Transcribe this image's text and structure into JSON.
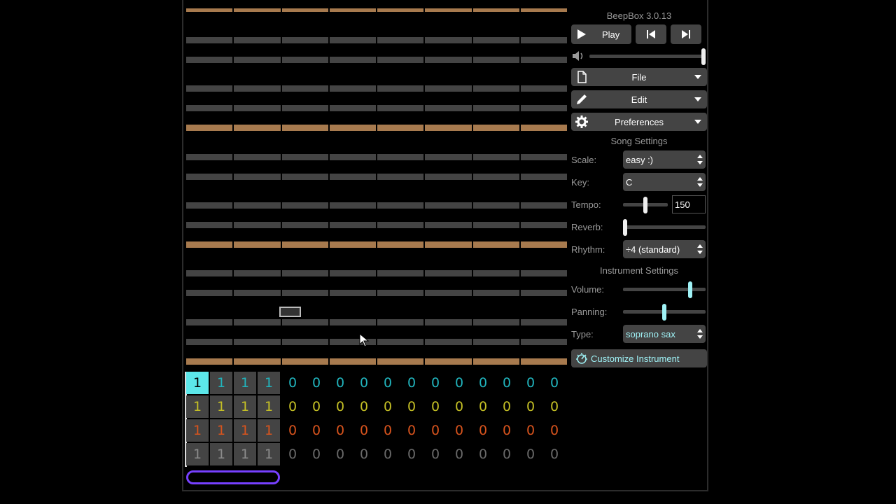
{
  "app": {
    "title": "BeepBox 3.0.13"
  },
  "transport": {
    "play_label": "Play",
    "volume_fraction": 1.0
  },
  "menus": {
    "file": "File",
    "edit": "Edit",
    "preferences": "Preferences"
  },
  "song_settings": {
    "heading": "Song Settings",
    "scale_label": "Scale:",
    "scale_value": "easy :)",
    "key_label": "Key:",
    "key_value": "C",
    "tempo_label": "Tempo:",
    "tempo_value": "150",
    "tempo_fraction": 0.5,
    "reverb_label": "Reverb:",
    "reverb_fraction": 0.0,
    "rhythm_label": "Rhythm:",
    "rhythm_value": "÷4 (standard)"
  },
  "instrument_settings": {
    "heading": "Instrument Settings",
    "volume_label": "Volume:",
    "volume_fraction": 0.83,
    "panning_label": "Panning:",
    "panning_fraction": 0.5,
    "type_label": "Type:",
    "type_value": "soprano sax",
    "customize_label": "Customize Instrument"
  },
  "pattern_grid": {
    "channels": [
      {
        "color": "c0",
        "values": [
          "1",
          "1",
          "1",
          "1",
          "0",
          "0",
          "0",
          "0",
          "0",
          "0",
          "0",
          "0",
          "0",
          "0",
          "0",
          "0"
        ]
      },
      {
        "color": "c1",
        "values": [
          "1",
          "1",
          "1",
          "1",
          "0",
          "0",
          "0",
          "0",
          "0",
          "0",
          "0",
          "0",
          "0",
          "0",
          "0",
          "0"
        ]
      },
      {
        "color": "c2",
        "values": [
          "1",
          "1",
          "1",
          "1",
          "0",
          "0",
          "0",
          "0",
          "0",
          "0",
          "0",
          "0",
          "0",
          "0",
          "0",
          "0"
        ]
      },
      {
        "color": "c3",
        "values": [
          "1",
          "1",
          "1",
          "1",
          "0",
          "0",
          "0",
          "0",
          "0",
          "0",
          "0",
          "0",
          "0",
          "0",
          "0",
          "0"
        ]
      }
    ]
  },
  "colors": {
    "accent_cyan": "#5ce7ea",
    "tonic_row": "#a77a4e",
    "loop_outline": "#7740ff"
  }
}
